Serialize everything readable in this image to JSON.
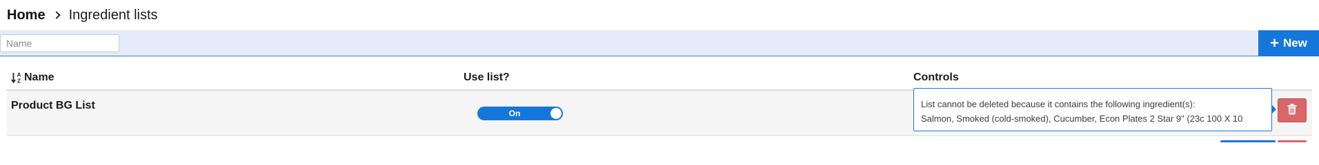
{
  "breadcrumb": {
    "home": "Home",
    "current": "Ingredient lists"
  },
  "filter": {
    "name_placeholder": "Name",
    "name_value": ""
  },
  "toolbar": {
    "new_label": "New",
    "new_icon": "plus-icon"
  },
  "table": {
    "columns": [
      "Name",
      "Use list?",
      "Controls"
    ],
    "rows": [
      {
        "name": "Product BG List",
        "use_list": "On",
        "use_list_enabled": true
      }
    ]
  },
  "tooltip": {
    "line1": "List cannot be deleted because it contains the following ingredient(s):",
    "line2": "Salmon, Smoked (cold-smoked), Cucumber, Econ Plates 2 Star 9\" (23c 100 X 10"
  },
  "colors": {
    "accent": "#1477d9",
    "filter_bar": "#e6ebfa",
    "row_bg": "#f5f5f5",
    "danger": "#d9676a"
  }
}
